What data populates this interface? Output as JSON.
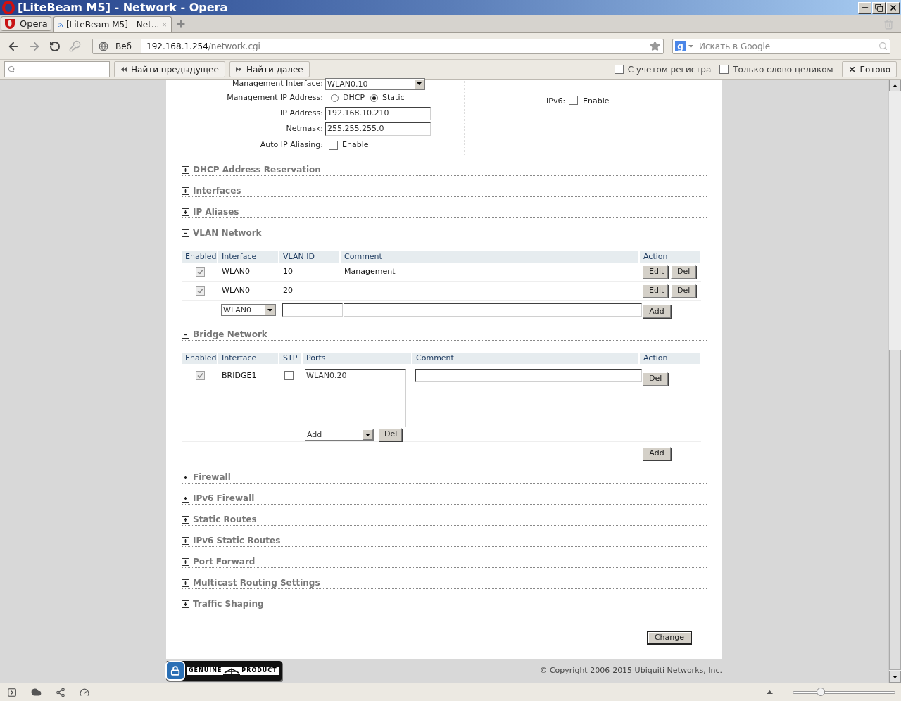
{
  "window": {
    "title": "[LiteBeam M5] - Network - Opera"
  },
  "opera_menu": "Opera",
  "tabs": [
    {
      "label": "[LiteBeam M5] - Net...",
      "selected": true
    }
  ],
  "address_bar": {
    "site_badge": "Веб",
    "url_host": "192.168.1.254",
    "url_path": "/network.cgi"
  },
  "search": {
    "engine_badge": "g",
    "placeholder": "Искать в Google"
  },
  "find_bar": {
    "previous": "Найти предыдущее",
    "next": "Найти далее",
    "options": [
      {
        "label": "С учетом регистра",
        "checked": false
      },
      {
        "label": "Только слово целиком",
        "checked": false
      }
    ],
    "done": "Готово"
  },
  "management": {
    "interface_label": "Management Interface:",
    "interface_value": "WLAN0.10",
    "ip_mode_label": "Management IP Address:",
    "ip_modes": [
      {
        "label": "DHCP",
        "selected": false
      },
      {
        "label": "Static",
        "selected": true
      }
    ],
    "ip_label": "IP Address:",
    "ip_value": "192.168.10.210",
    "netmask_label": "Netmask:",
    "netmask_value": "255.255.255.0",
    "aliasing_label": "Auto IP Aliasing:",
    "aliasing": {
      "label": "Enable",
      "checked": false
    },
    "ipv6_label": "IPv6:",
    "ipv6": {
      "label": "Enable",
      "checked": false
    }
  },
  "sections": [
    {
      "title": "DHCP Address Reservation",
      "expanded": false
    },
    {
      "title": "Interfaces",
      "expanded": false
    },
    {
      "title": "IP Aliases",
      "expanded": false
    },
    {
      "title": "VLAN Network",
      "expanded": true,
      "kind": "vlan",
      "table": {
        "columns": [
          "Enabled",
          "Interface",
          "VLAN ID",
          "Comment",
          "Action"
        ],
        "rows": [
          {
            "enabled": true,
            "interface": "WLAN0",
            "vlan_id": "10",
            "comment": "Management",
            "actions": [
              "Edit",
              "Del"
            ]
          },
          {
            "enabled": true,
            "interface": "WLAN0",
            "vlan_id": "20",
            "actions": [
              "Edit",
              "Del"
            ]
          }
        ],
        "new_row": {
          "interface": "WLAN0",
          "add": "Add"
        }
      }
    },
    {
      "title": "Bridge Network",
      "expanded": true,
      "kind": "bridge",
      "table": {
        "columns": [
          "Enabled",
          "Interface",
          "STP",
          "Ports",
          "Comment",
          "Action"
        ],
        "rows": [
          {
            "enabled": true,
            "interface": "BRIDGE1",
            "stp": false,
            "ports": [
              "WLAN0.20"
            ],
            "port_select": "Add",
            "port_del": "Del",
            "action": "Del"
          }
        ],
        "add": "Add"
      }
    },
    {
      "title": "Firewall",
      "expanded": false
    },
    {
      "title": "IPv6 Firewall",
      "expanded": false
    },
    {
      "title": "Static Routes",
      "expanded": false
    },
    {
      "title": "IPv6 Static Routes",
      "expanded": false
    },
    {
      "title": "Port Forward",
      "expanded": false
    },
    {
      "title": "Multicast Routing Settings",
      "expanded": false
    },
    {
      "title": "Traffic Shaping",
      "expanded": false
    }
  ],
  "change_button": "Change",
  "footer": {
    "badge_left": "GENUINE",
    "badge_right": "PRODUCT",
    "copyright": "© Copyright 2006-2015 Ubiquiti Networks, Inc."
  },
  "status_bar": {
    "zoom": {
      "level": 0.27
    }
  }
}
